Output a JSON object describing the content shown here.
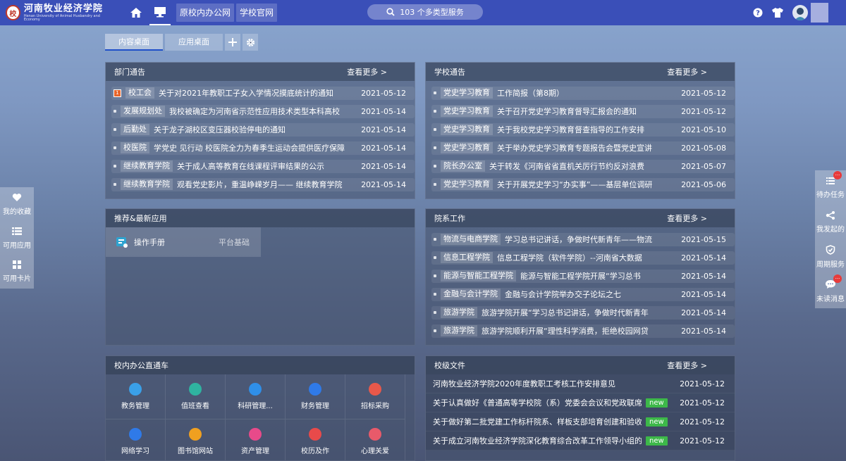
{
  "topbar": {
    "logo_text": "河南牧业经济学院",
    "logo_en": "Henan University of Animal Husbandry and Economy",
    "links": [
      "原校内办公网",
      "学校官网"
    ],
    "search_text": "103 个多类型服务"
  },
  "tabs": [
    "内容桌面",
    "应用桌面"
  ],
  "dept_notice": {
    "title": "部门通告",
    "more": "查看更多 >",
    "rows": [
      {
        "cat": "校工会",
        "title": "关于对2021年教职工子女入学情况摸底统计的通知",
        "date": "2021-05-12"
      },
      {
        "cat": "发展规划处",
        "title": "我校被确定为河南省示范性应用技术类型本科高校",
        "date": "2021-05-14"
      },
      {
        "cat": "后勤处",
        "title": "关于龙子湖校区变压器校验停电的通知",
        "date": "2021-05-14"
      },
      {
        "cat": "校医院",
        "title": "学党史 见行动 校医院全力为春季生运动会提供医疗保障",
        "date": "2021-05-14"
      },
      {
        "cat": "继续教育学院",
        "title": "关于成人高等教育在线课程评审结果的公示",
        "date": "2021-05-14"
      },
      {
        "cat": "继续教育学院",
        "title": "观看党史影片，重温峥嵘岁月—— 继续教育学院",
        "date": "2021-05-14"
      }
    ]
  },
  "school_notice": {
    "title": "学校通告",
    "more": "查看更多 >",
    "rows": [
      {
        "cat": "党史学习教育",
        "title": "工作简报（第8期）",
        "date": "2021-05-12"
      },
      {
        "cat": "党史学习教育",
        "title": "关于召开党史学习教育督导汇报会的通知",
        "date": "2021-05-12"
      },
      {
        "cat": "党史学习教育",
        "title": "关于我校党史学习教育督查指导的工作安排",
        "date": "2021-05-10"
      },
      {
        "cat": "党史学习教育",
        "title": "关于举办党史学习教育专题报告会暨党史宣讲",
        "date": "2021-05-08"
      },
      {
        "cat": "院长办公室",
        "title": "关于转发《河南省省直机关厉行节约反对浪费",
        "date": "2021-05-07"
      },
      {
        "cat": "党史学习教育",
        "title": "关于开展党史学习“办实事”——基层单位调研",
        "date": "2021-05-06"
      }
    ]
  },
  "recommend": {
    "title": "推荐&最新应用",
    "app_name": "操作手册",
    "app_source": "平台基础"
  },
  "college_work": {
    "title": "院系工作",
    "more": "查看更多 >",
    "rows": [
      {
        "cat": "物流与电商学院",
        "title": "学习总书记讲话，争做时代新青年——物流",
        "date": "2021-05-15"
      },
      {
        "cat": "信息工程学院",
        "title": "信息工程学院（软件学院）--河南省大数据",
        "date": "2021-05-14"
      },
      {
        "cat": "能源与智能工程学院",
        "title": "能源与智能工程学院开展“学习总书",
        "date": "2021-05-14"
      },
      {
        "cat": "金融与会计学院",
        "title": "金融与会计学院举办交子论坛之七",
        "date": "2021-05-14"
      },
      {
        "cat": "旅游学院",
        "title": "旅游学院开展“学习总书记讲话，争做时代新青年",
        "date": "2021-05-14"
      },
      {
        "cat": "旅游学院",
        "title": "旅游学院顺利开展“理性科学消费，拒绝校园网贷",
        "date": "2021-05-14"
      }
    ]
  },
  "office": {
    "title": "校内办公直通车",
    "items": [
      "教务管理",
      "值班查看",
      "科研管理...",
      "财务管理",
      "招标采购",
      "网络学习",
      "图书馆网站",
      "资产管理",
      "校历及作",
      "心理关爱"
    ],
    "colors": [
      "#3aa0e8",
      "#2fb3a0",
      "#2f8fe8",
      "#2f7ae8",
      "#e8584a",
      "#2f7ae8",
      "#f0a020",
      "#e84a8a",
      "#e84a4a",
      "#e85a6a"
    ]
  },
  "school_files": {
    "title": "校级文件",
    "more": "查看更多 >",
    "new_label": "new",
    "rows": [
      {
        "title": "河南牧业经济学院2020年度教职工考核工作安排意见",
        "date": "2021-05-12",
        "new": false
      },
      {
        "title": "关于认真做好《普通高等学校院（系）党委会会议和党政联席会议",
        "date": "2021-05-12",
        "new": true
      },
      {
        "title": "关于做好第二批党建工作标杆院系、样板支部培育创建和验收工作",
        "date": "2021-05-12",
        "new": true
      },
      {
        "title": "关于成立河南牧业经济学院深化教育综合改革工作领导小组的通知",
        "date": "2021-05-12",
        "new": true
      }
    ]
  },
  "left_sidebar": [
    "我的收藏",
    "可用应用",
    "可用卡片"
  ],
  "right_sidebar": [
    "待办任务",
    "我发起的",
    "周期服务",
    "未读消息"
  ],
  "badge_text": "···",
  "top_badge": "1"
}
